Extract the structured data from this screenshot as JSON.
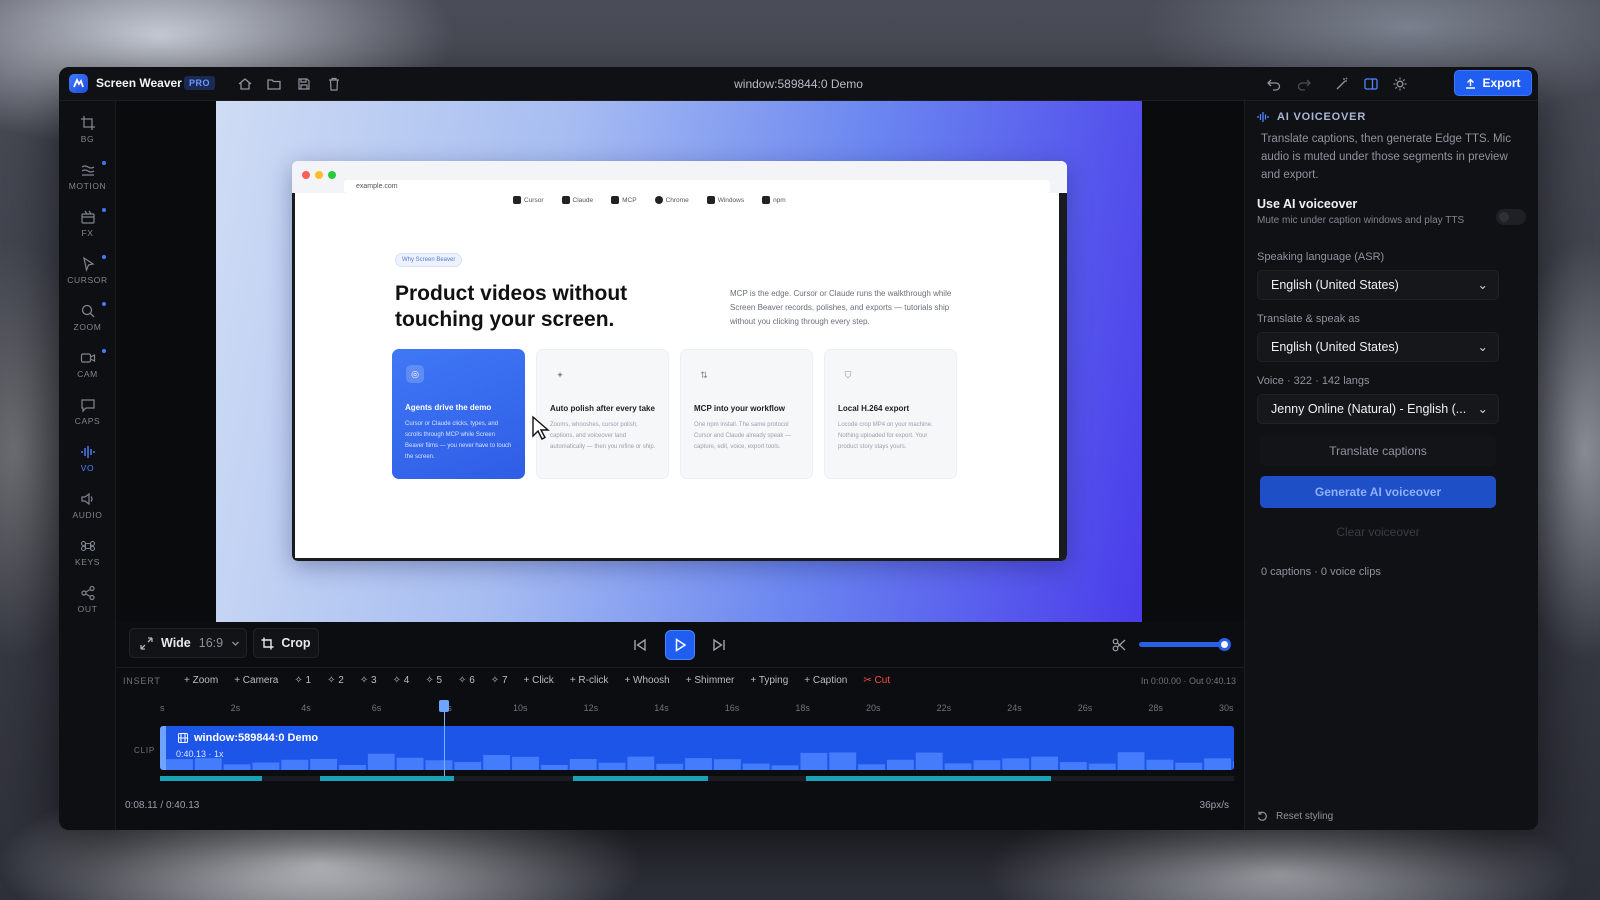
{
  "app": {
    "name": "Screen Weaver",
    "badge": "PRO",
    "window_title": "window:589844:0 Demo",
    "export_label": "Export"
  },
  "sidebar": {
    "items": [
      {
        "label": "BG",
        "icon": "crop-grid-icon",
        "dot": false
      },
      {
        "label": "MOTION",
        "icon": "motion-icon",
        "dot": true
      },
      {
        "label": "FX",
        "icon": "fx-icon",
        "dot": true
      },
      {
        "label": "CURSOR",
        "icon": "cursor-icon",
        "dot": true
      },
      {
        "label": "ZOOM",
        "icon": "zoom-icon",
        "dot": true
      },
      {
        "label": "CAM",
        "icon": "camera-icon",
        "dot": true
      },
      {
        "label": "CAPS",
        "icon": "captions-icon",
        "dot": false
      },
      {
        "label": "VO",
        "icon": "voiceover-icon",
        "dot": false,
        "active": true
      },
      {
        "label": "AUDIO",
        "icon": "audio-icon",
        "dot": false
      },
      {
        "label": "KEYS",
        "icon": "keys-icon",
        "dot": false
      },
      {
        "label": "OUT",
        "icon": "share-icon",
        "dot": false
      }
    ]
  },
  "preview": {
    "url": "example.com",
    "nav": [
      "Cursor",
      "Claude",
      "MCP",
      "Chrome",
      "Windows",
      "npm"
    ],
    "pill": "Why Screen Beaver",
    "headline": "Product videos without touching your screen.",
    "sub": "MCP is the edge. Cursor or Claude runs the walkthrough while Screen Beaver records, polishes, and exports — tutorials ship without you clicking through every step.",
    "cards": [
      {
        "title": "Agents drive the demo",
        "desc": "Cursor or Claude clicks, types, and scrolls through MCP while Screen Beaver films — you never have to touch the screen."
      },
      {
        "title": "Auto polish after every take",
        "desc": "Zooms, whooshes, cursor polish, captions, and voiceover land automatically — then you refine or ship."
      },
      {
        "title": "MCP into your workflow",
        "desc": "One npm install. The same protocol Cursor and Claude already speak — capture, edit, voice, export tools."
      },
      {
        "title": "Local H.264 export",
        "desc": "Locode crop MP4 on your machine. Nothing uploaded for export. Your product story stays yours."
      }
    ]
  },
  "controls": {
    "aspect_label": "Wide",
    "aspect_ratio": "16:9",
    "crop_label": "Crop"
  },
  "insert": {
    "label": "INSERT",
    "items": [
      "+ Zoom",
      "+ Camera",
      "1",
      "2",
      "3",
      "4",
      "5",
      "6",
      "7",
      "+ Click",
      "+ R-click",
      "+ Whoosh",
      "+ Shimmer",
      "+ Typing",
      "+ Caption"
    ],
    "cut": "Cut",
    "inout": "In 0:00.00 · Out 0:40.13"
  },
  "timeline": {
    "ticks": [
      "s",
      "2s",
      "4s",
      "6s",
      "8s",
      "10s",
      "12s",
      "14s",
      "16s",
      "18s",
      "20s",
      "22s",
      "24s",
      "26s",
      "28s",
      "30s"
    ],
    "track_label": "CLIP",
    "clip_name": "window:589844:0 Demo",
    "clip_sub": "0:40.13 · 1x",
    "time": "0:08.11 / 0:40.13",
    "zoom": "36px/s"
  },
  "panel": {
    "header": "AI VOICEOVER",
    "desc": "Translate captions, then generate Edge TTS. Mic audio is muted under those segments in preview and export.",
    "use_title": "Use AI voiceover",
    "use_sub": "Mute mic under caption windows and play TTS",
    "lang_label": "Speaking language (ASR)",
    "lang_value": "English (United States)",
    "trans_label": "Translate & speak as",
    "trans_value": "English (United States)",
    "voice_label": "Voice · 322 · 142 langs",
    "voice_value": "Jenny Online (Natural) - English (...",
    "translate_btn": "Translate captions",
    "generate_btn": "Generate AI voiceover",
    "clear_btn": "Clear voiceover",
    "counts": "0 captions · 0 voice clips",
    "reset": "Reset styling"
  },
  "colors": {
    "accent": "#1f5ef0",
    "cut": "#ff4b4b",
    "segment": "#1aa2b8"
  }
}
